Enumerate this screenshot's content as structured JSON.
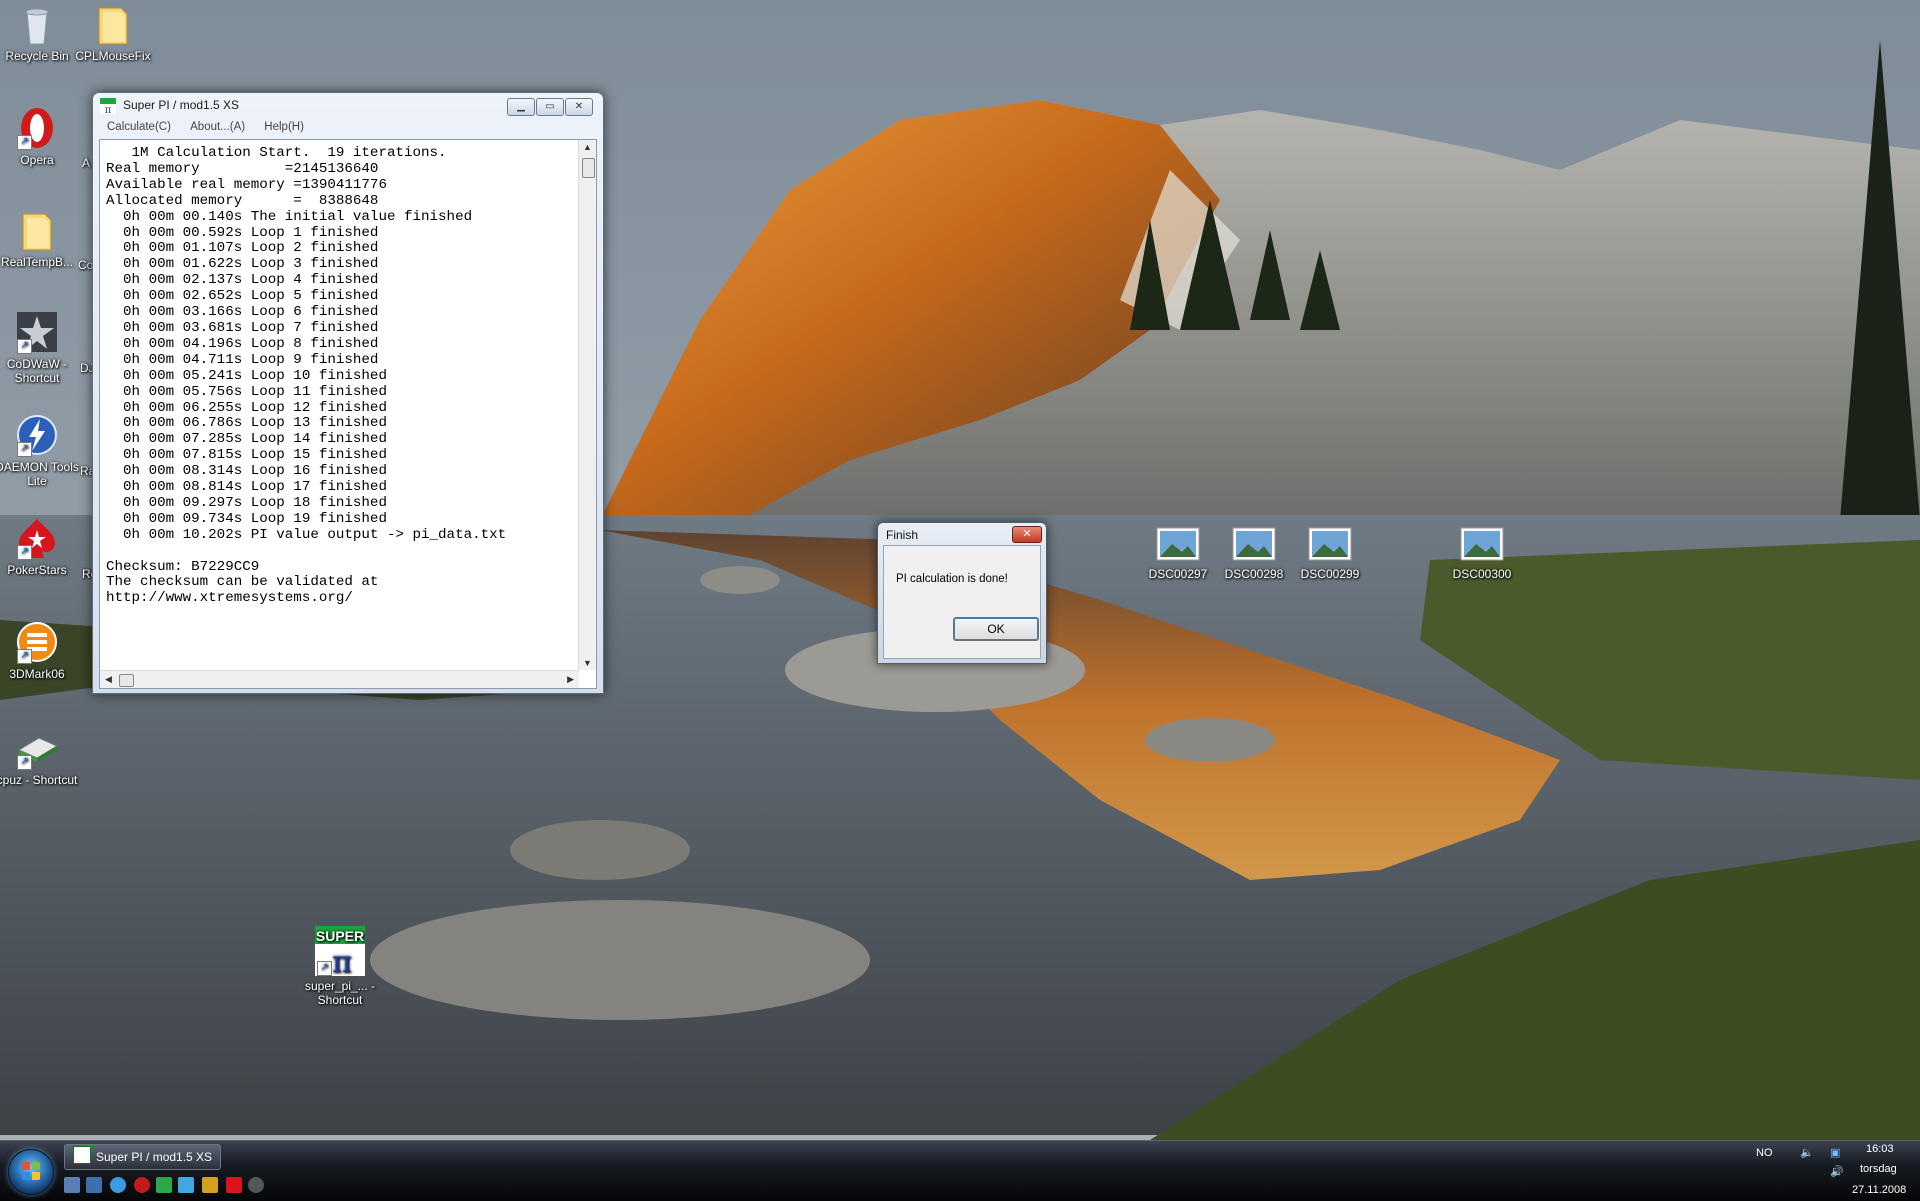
{
  "desktop": {
    "icons": [
      {
        "id": "recycle-bin",
        "label": "Recycle Bin"
      },
      {
        "id": "cplmousefix",
        "label": "CPLMouseFix"
      },
      {
        "id": "opera",
        "label": "Opera"
      },
      {
        "id": "realtempb",
        "label": "RealTempB..."
      },
      {
        "id": "codwaw",
        "label": "CoDWaW - Shortcut"
      },
      {
        "id": "daemon",
        "label": "DAEMON Tools Lite"
      },
      {
        "id": "pokerstars",
        "label": "PokerStars"
      },
      {
        "id": "3dmark06",
        "label": "3DMark06"
      },
      {
        "id": "cpuz",
        "label": "cpuz - Shortcut"
      },
      {
        "id": "superpi",
        "label": "super_pi_... - Shortcut"
      },
      {
        "id": "dsc297",
        "label": "DSC00297"
      },
      {
        "id": "dsc298",
        "label": "DSC00298"
      },
      {
        "id": "dsc299",
        "label": "DSC00299"
      },
      {
        "id": "dsc300",
        "label": "DSC00300"
      }
    ],
    "partial_labels": [
      "A",
      "Co",
      "DJ",
      "Ra",
      "Re"
    ]
  },
  "superpi_window": {
    "title": "Super PI / mod1.5 XS",
    "menu": [
      "Calculate(C)",
      "About...(A)",
      "Help(H)"
    ],
    "log_text": "   1M Calculation Start.  19 iterations.\nReal memory          =2145136640\nAvailable real memory =1390411776\nAllocated memory      =  8388648\n  0h 00m 00.140s The initial value finished\n  0h 00m 00.592s Loop 1 finished\n  0h 00m 01.107s Loop 2 finished\n  0h 00m 01.622s Loop 3 finished\n  0h 00m 02.137s Loop 4 finished\n  0h 00m 02.652s Loop 5 finished\n  0h 00m 03.166s Loop 6 finished\n  0h 00m 03.681s Loop 7 finished\n  0h 00m 04.196s Loop 8 finished\n  0h 00m 04.711s Loop 9 finished\n  0h 00m 05.241s Loop 10 finished\n  0h 00m 05.756s Loop 11 finished\n  0h 00m 06.255s Loop 12 finished\n  0h 00m 06.786s Loop 13 finished\n  0h 00m 07.285s Loop 14 finished\n  0h 00m 07.815s Loop 15 finished\n  0h 00m 08.314s Loop 16 finished\n  0h 00m 08.814s Loop 17 finished\n  0h 00m 09.297s Loop 18 finished\n  0h 00m 09.734s Loop 19 finished\n  0h 00m 10.202s PI value output -> pi_data.txt\n\nChecksum: B7229CC9\nThe checksum can be validated at\nhttp://www.xtremesystems.org/"
  },
  "dialog": {
    "title": "Finish",
    "message": "PI calculation is done!",
    "ok_label": "OK",
    "close_glyph": "✕"
  },
  "taskbar": {
    "task_label": "Super PI / mod1.5 XS",
    "language": "NO",
    "time": "16:03",
    "day": "torsdag",
    "date": "27.11.2008"
  },
  "colors": {
    "accent": "#2a6eb0",
    "close_red": "#c23a24"
  }
}
